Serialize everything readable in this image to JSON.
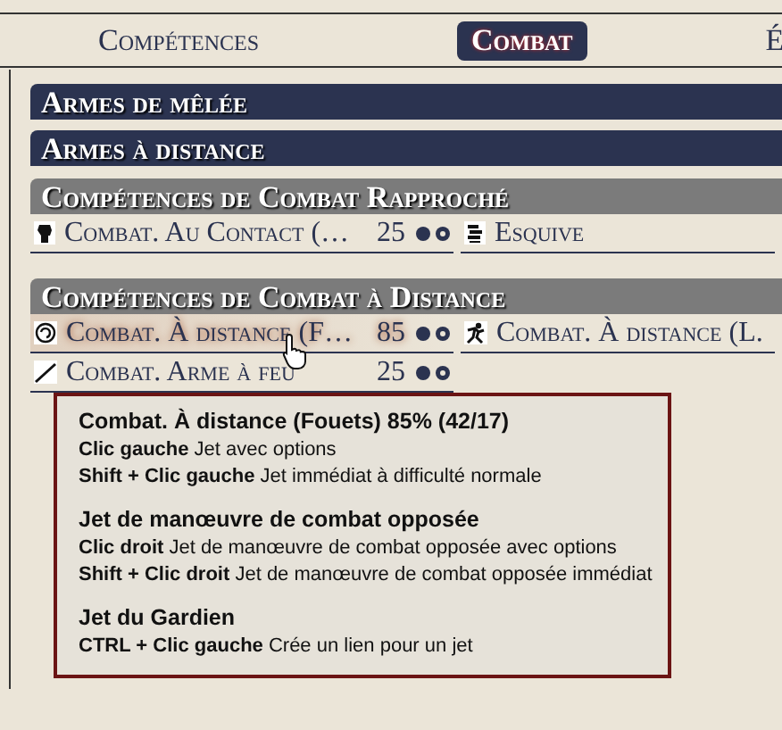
{
  "tabs": [
    {
      "label": "Compétences",
      "selected": false
    },
    {
      "label": "Combat",
      "selected": true
    },
    {
      "label": "É",
      "selected": false
    }
  ],
  "sections": [
    {
      "title": "Armes de mêlée",
      "kind": "category"
    },
    {
      "title": "Armes à distance",
      "kind": "category"
    },
    {
      "title": "Compétences de Combat Rapproché",
      "kind": "group",
      "skills": [
        {
          "name": "Combat. Au Contact (…",
          "value": "25",
          "hovered": false
        },
        {
          "name": "Esquive",
          "hovered": false
        }
      ]
    },
    {
      "title": "Compétences de Combat à Distance",
      "kind": "group",
      "skills": [
        {
          "name": "Combat. À distance (F…",
          "value": "85",
          "hovered": true
        },
        {
          "name": "Combat. À distance (L.",
          "hovered": false
        },
        {
          "name": "Combat. Arme à feu",
          "value": "25",
          "hovered": false
        }
      ]
    }
  ],
  "tooltip": {
    "title": "Combat. À distance (Fouets) 85% (42/17)",
    "groups": [
      {
        "lines": [
          "**Clic gauche** Jet avec options",
          "**Shift + Clic gauche** Jet immédiat à difficulté normale"
        ]
      },
      {
        "heading": "Jet de manœuvre de combat opposée",
        "lines": [
          "**Clic droit** Jet de manœuvre de combat opposée avec options",
          "**Shift + Clic droit** Jet de manœuvre de combat opposée immédiat"
        ]
      },
      {
        "heading": "Jet du Gardien",
        "lines": [
          "**CTRL + Clic gauche** Crée un lien pour un jet"
        ]
      }
    ]
  }
}
